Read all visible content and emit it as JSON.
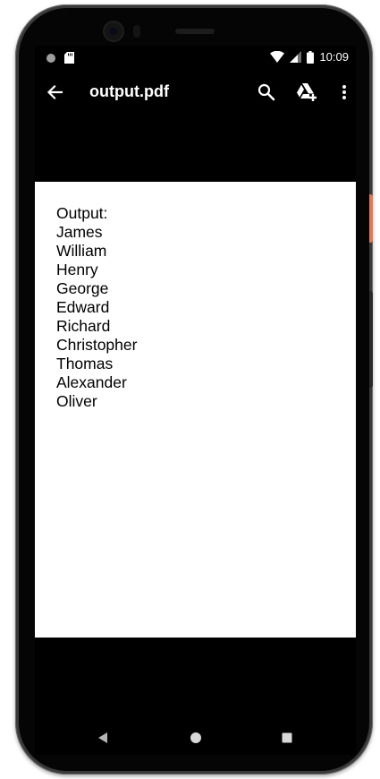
{
  "status_bar": {
    "time": "10:09",
    "icons": [
      "notification-dot-icon",
      "sd-card-icon",
      "wifi-icon",
      "cellular-signal-icon",
      "battery-icon"
    ]
  },
  "app_bar": {
    "title": "output.pdf",
    "icons": [
      "arrow-back-icon",
      "search-icon",
      "drive-add-icon",
      "more-vert-icon"
    ]
  },
  "document": {
    "lines": [
      "Output:",
      "James",
      "William",
      "Henry",
      "George",
      "Edward",
      "Richard",
      "Christopher",
      "Thomas",
      "Alexander",
      "Oliver"
    ]
  },
  "nav_bar": {
    "icons": [
      "nav-back-triangle-icon",
      "nav-home-circle-icon",
      "nav-recents-square-icon"
    ]
  },
  "colors": {
    "screen_background": "#000000",
    "page_background": "#ffffff",
    "text": "#000000",
    "chrome_text": "#ffffff",
    "device_frame": "#3a3a3a",
    "power_button_accent": "#e07a55"
  }
}
